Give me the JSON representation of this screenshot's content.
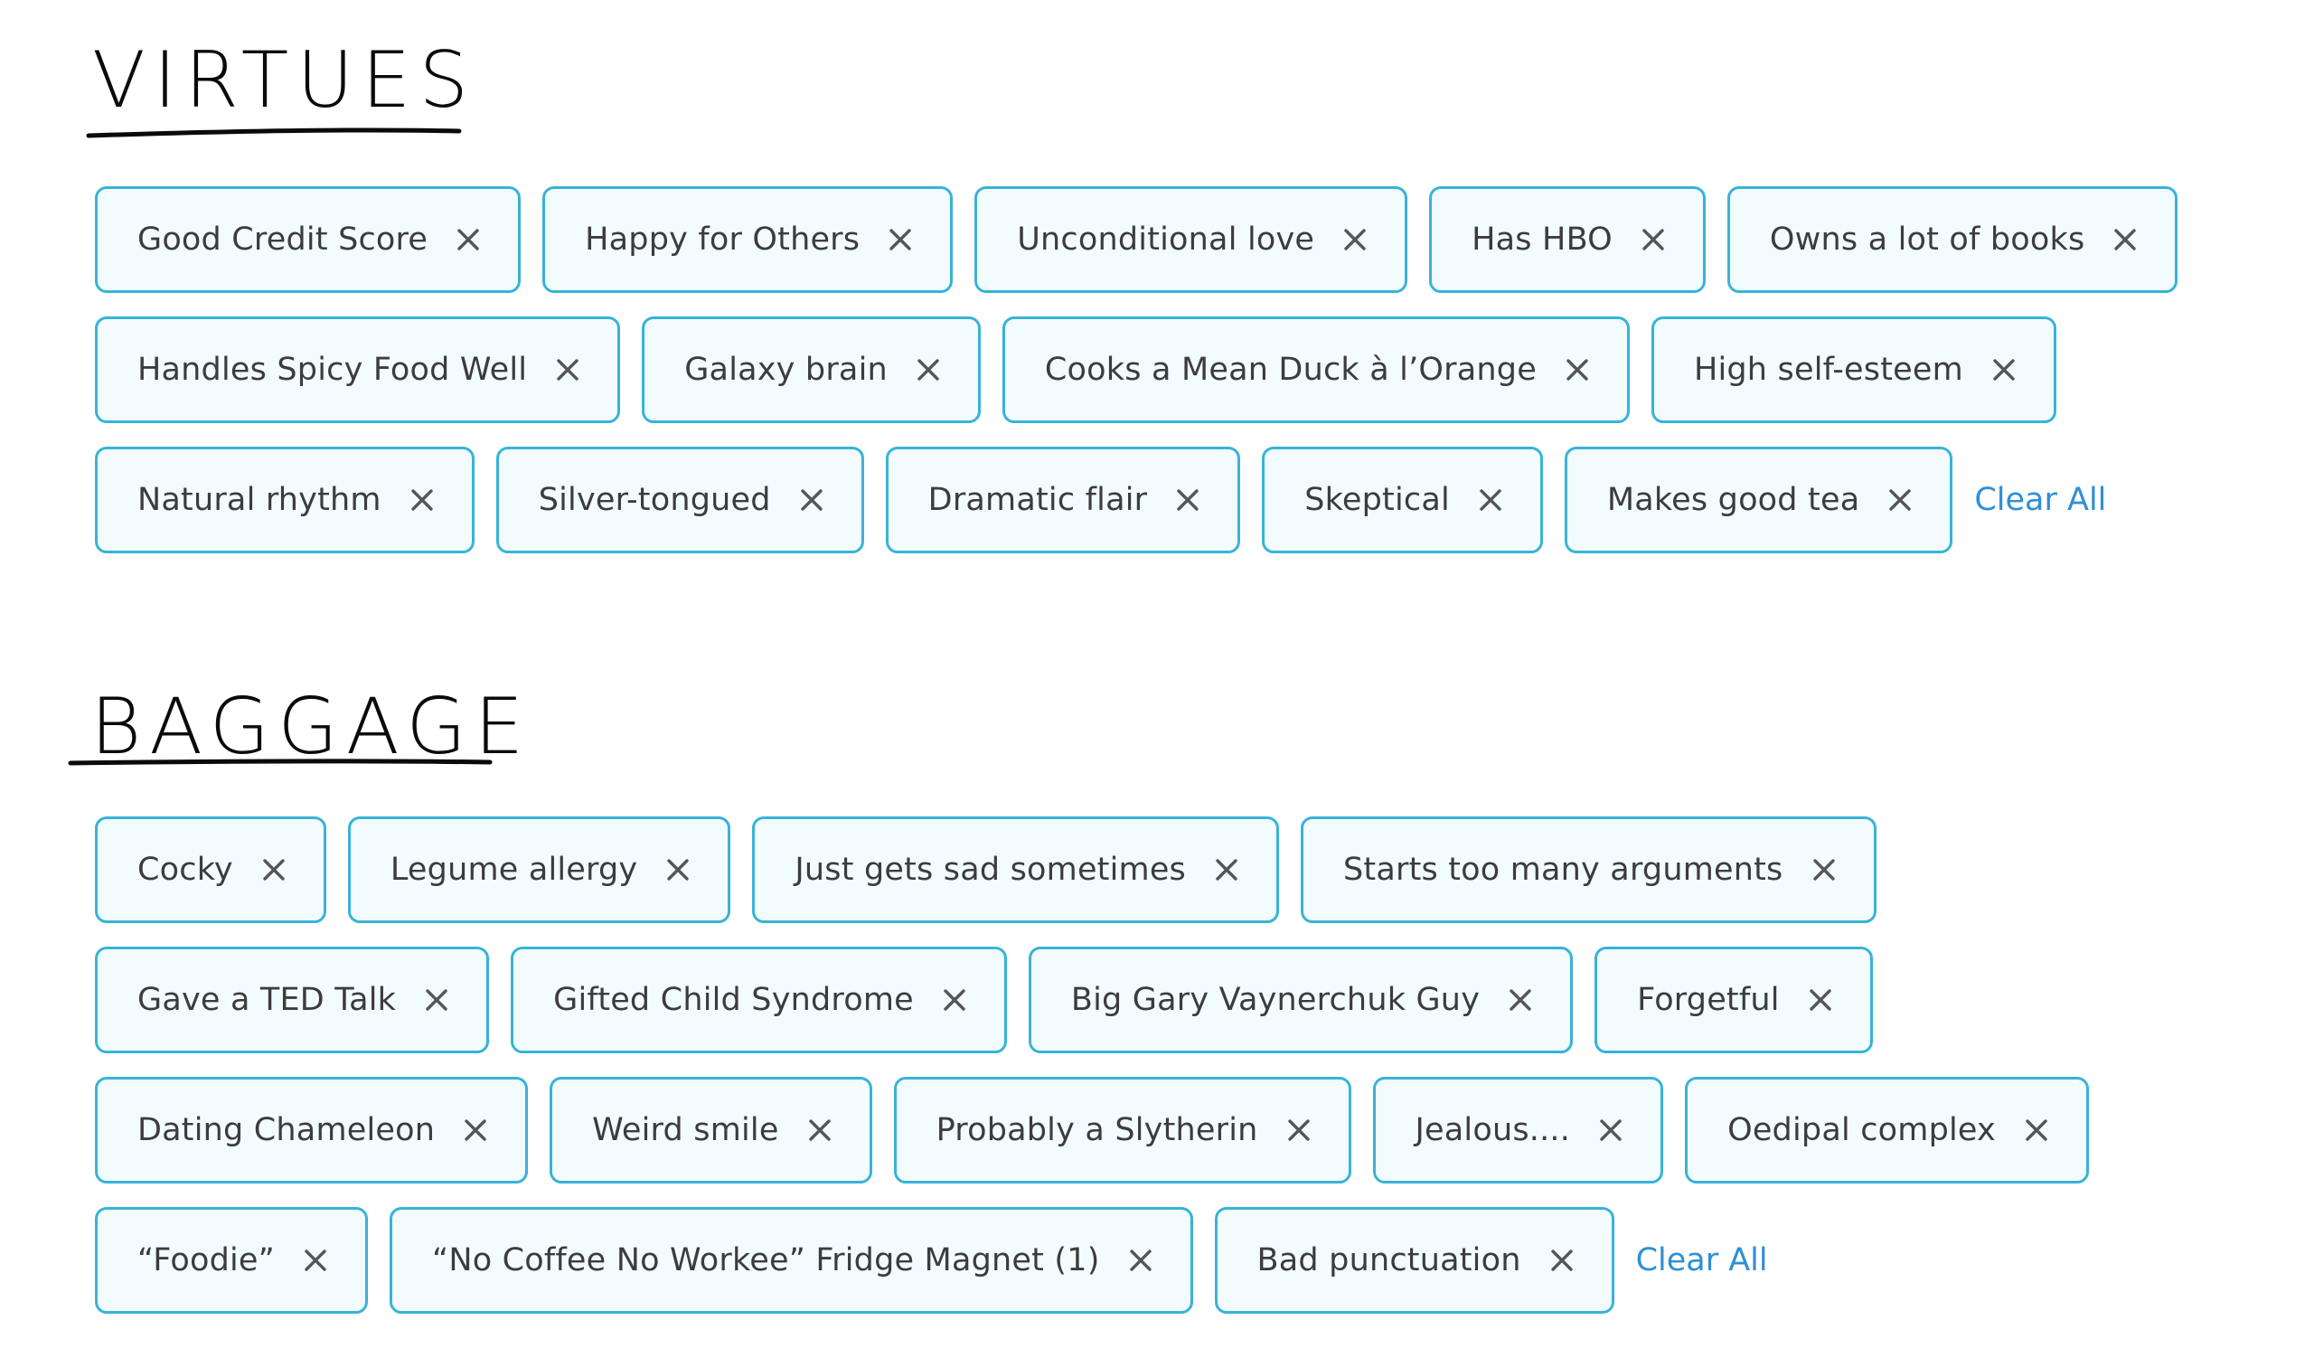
{
  "colors": {
    "chip_border": "#38b3d8",
    "chip_background": "#f2fbfe",
    "chip_text": "#3c3c3c",
    "close_icon": "#555555",
    "clear_all_link": "#2f8fd6",
    "heading": "#0a0a0a"
  },
  "virtues": {
    "heading": "VIRTUES",
    "clear_all_label": "Clear All",
    "rows": [
      [
        {
          "label": "Good Credit Score",
          "icon": "close-icon"
        },
        {
          "label": "Happy for Others",
          "icon": "close-icon"
        },
        {
          "label": "Unconditional love",
          "icon": "close-icon"
        },
        {
          "label": "Has HBO",
          "icon": "close-icon"
        },
        {
          "label": "Owns a lot of books",
          "icon": "close-icon"
        }
      ],
      [
        {
          "label": "Handles Spicy Food Well",
          "icon": "close-icon"
        },
        {
          "label": "Galaxy brain",
          "icon": "close-icon"
        },
        {
          "label": "Cooks a Mean Duck à l’Orange",
          "icon": "close-icon"
        },
        {
          "label": "High self-esteem",
          "icon": "close-icon"
        }
      ],
      [
        {
          "label": "Natural rhythm",
          "icon": "close-icon"
        },
        {
          "label": "Silver-tongued",
          "icon": "close-icon"
        },
        {
          "label": "Dramatic flair",
          "icon": "close-icon"
        },
        {
          "label": "Skeptical",
          "icon": "close-icon"
        },
        {
          "label": "Makes good tea",
          "icon": "close-icon"
        }
      ]
    ]
  },
  "baggage": {
    "heading": "BAGGAGE",
    "clear_all_label": "Clear All",
    "rows": [
      [
        {
          "label": "Cocky",
          "icon": "close-icon"
        },
        {
          "label": "Legume allergy",
          "icon": "close-icon"
        },
        {
          "label": "Just gets sad sometimes",
          "icon": "close-icon"
        },
        {
          "label": "Starts too many arguments",
          "icon": "close-icon"
        }
      ],
      [
        {
          "label": "Gave a TED Talk",
          "icon": "close-icon"
        },
        {
          "label": "Gifted Child Syndrome",
          "icon": "close-icon"
        },
        {
          "label": "Big Gary Vaynerchuk Guy",
          "icon": "close-icon"
        },
        {
          "label": "Forgetful",
          "icon": "close-icon"
        }
      ],
      [
        {
          "label": "Dating Chameleon",
          "icon": "close-icon"
        },
        {
          "label": "Weird smile",
          "icon": "close-icon"
        },
        {
          "label": "Probably a Slytherin",
          "icon": "close-icon"
        },
        {
          "label": "Jealous....",
          "icon": "close-icon"
        },
        {
          "label": "Oedipal complex",
          "icon": "close-icon"
        }
      ],
      [
        {
          "label": "“Foodie”",
          "icon": "close-icon"
        },
        {
          "label": "“No Coffee No Workee” Fridge Magnet (1)",
          "icon": "close-icon"
        },
        {
          "label": "Bad punctuation",
          "icon": "close-icon"
        }
      ]
    ]
  }
}
